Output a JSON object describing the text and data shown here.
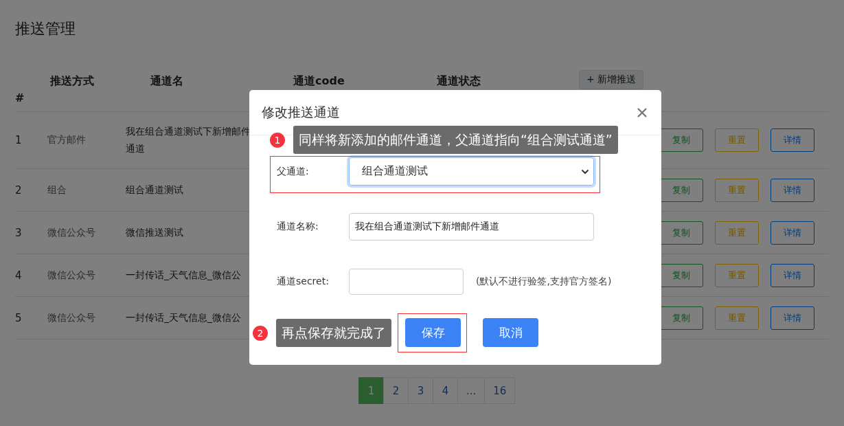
{
  "page": {
    "title": "推送管理"
  },
  "table": {
    "columns": [
      "#",
      "推送方式",
      "通道名",
      "通道code",
      "通道状态"
    ],
    "add_button": "+ 新增推送",
    "rows": [
      {
        "index": "1",
        "method": "官方邮件",
        "name": "我在组合通道测试下新增邮件通道",
        "actions": [
          {
            "label": "复制",
            "kind": "copy"
          },
          {
            "label": "重置",
            "kind": "reset"
          },
          {
            "label": "详情",
            "kind": "detail"
          }
        ]
      },
      {
        "index": "2",
        "method": "组合",
        "name": "组合通道测试",
        "actions": [
          {
            "label": "复制",
            "kind": "copy"
          },
          {
            "label": "重置",
            "kind": "reset"
          },
          {
            "label": "详情",
            "kind": "detail"
          }
        ]
      },
      {
        "index": "3",
        "method": "微信公众号",
        "name": "微信推送测试",
        "actions": [
          {
            "label": "复制",
            "kind": "copy"
          },
          {
            "label": "重置",
            "kind": "reset"
          },
          {
            "label": "详情",
            "kind": "detail"
          }
        ]
      },
      {
        "index": "4",
        "method": "微信公众号",
        "name": "一封传话_天气信息_微信公",
        "actions": [
          {
            "label": "复制",
            "kind": "copy"
          },
          {
            "label": "重置",
            "kind": "reset"
          },
          {
            "label": "详情",
            "kind": "detail"
          }
        ]
      },
      {
        "index": "5",
        "method": "微信公众号",
        "name": "一封传话_天气信息_微信公",
        "actions": [
          {
            "label": "复制",
            "kind": "copy"
          },
          {
            "label": "重置",
            "kind": "reset"
          },
          {
            "label": "详情",
            "kind": "detail"
          }
        ]
      }
    ]
  },
  "pagination": [
    {
      "label": "1",
      "selected": true
    },
    {
      "label": "2",
      "selected": false
    },
    {
      "label": "3",
      "selected": false
    },
    {
      "label": "4",
      "selected": false
    },
    {
      "label": "...",
      "selected": false
    },
    {
      "label": "16",
      "selected": false
    }
  ],
  "modal": {
    "title": "修改推送通道",
    "fields": [
      {
        "kind": "select",
        "label": "父通道:",
        "value": "组合通道测试",
        "focused": true
      },
      {
        "kind": "text",
        "label": "通道名称:",
        "value": "我在组合通道测试下新增邮件通道",
        "focused": false
      },
      {
        "kind": "short",
        "label": "通道secret:",
        "hint": "(默认不进行验签,支持官方签名)",
        "focused": false
      }
    ],
    "buttons": [
      "保存",
      "取消"
    ]
  },
  "annotations": [
    {
      "number": "1",
      "text": "同样将新添加的邮件通道，父通道指向“组合测试通道”"
    },
    {
      "number": "2",
      "text": "再点保存就完成了"
    }
  ]
}
